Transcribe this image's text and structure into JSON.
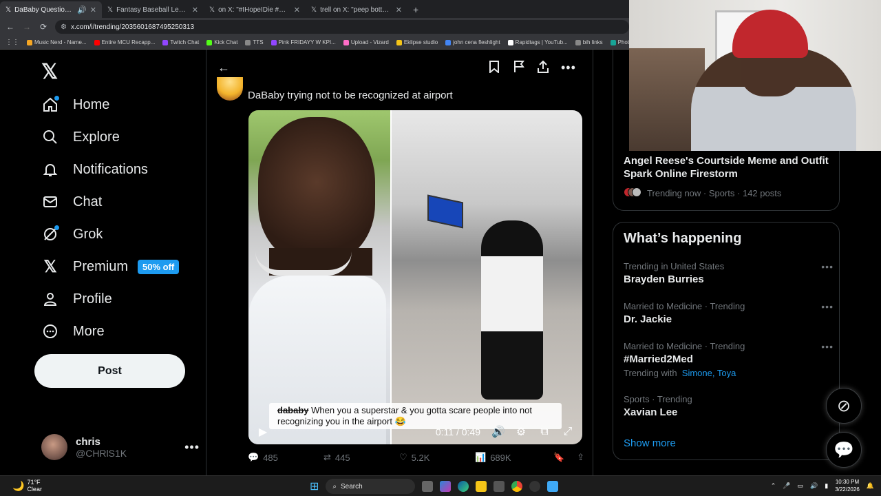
{
  "browser": {
    "tabs": [
      {
        "label": "DaBaby Questions Orange",
        "icon": "x-logo-icon",
        "active": true
      },
      {
        "label": "Fantasy Baseball League Creati",
        "icon": "x-logo-icon",
        "active": false
      },
      {
        "label": "on X: \"#IHopeIDie #WishingTh",
        "icon": "x-logo-icon",
        "active": false
      },
      {
        "label": "trell on X: \"peep bottom rig",
        "icon": "x-logo-icon",
        "active": false
      }
    ],
    "new_tab": "+",
    "url": "x.com/i/trending/2035601687495250313",
    "bookmarks": [
      {
        "label": "Music Nerd - Name...",
        "color": "#f5a623"
      },
      {
        "label": "Entire MCU Recapp...",
        "color": "#ff0000"
      },
      {
        "label": "Twitch Chat",
        "color": "#9146ff"
      },
      {
        "label": "Kick Chat",
        "color": "#53fc18"
      },
      {
        "label": "TTS",
        "color": "#888888"
      },
      {
        "label": "Pink FRIDAYY W KPI...",
        "color": "#9146ff"
      },
      {
        "label": "Upload - Vizard",
        "color": "#ff6ec7"
      },
      {
        "label": "Eklipse studio",
        "color": "#f5c518"
      },
      {
        "label": "john cena fleshlight",
        "color": "#4285f4"
      },
      {
        "label": "Rapidtags | YouTub...",
        "color": "#ffffff"
      },
      {
        "label": "bih links",
        "color": "#888888"
      },
      {
        "label": "Photopea",
        "color": "#18a497"
      }
    ]
  },
  "sidebar": {
    "items": [
      {
        "label": "Home",
        "icon": "home-icon"
      },
      {
        "label": "Explore",
        "icon": "search-icon"
      },
      {
        "label": "Notifications",
        "icon": "bell-icon"
      },
      {
        "label": "Chat",
        "icon": "mail-icon"
      },
      {
        "label": "Grok",
        "icon": "grok-icon"
      },
      {
        "label": "Premium",
        "icon": "x-logo-icon",
        "badge": "50% off"
      },
      {
        "label": "Profile",
        "icon": "person-icon"
      },
      {
        "label": "More",
        "icon": "more-circle-icon"
      }
    ],
    "post_label": "Post",
    "account": {
      "name": "chris",
      "handle": "@CHRlS1K"
    }
  },
  "tweet": {
    "text": "DaBaby trying not to be recognized at airport",
    "video": {
      "caption_user": "dababy",
      "caption_text": "When you a superstar & you gotta scare people into not recognizing you in the airport 😂",
      "time": "0:11 / 0:49"
    },
    "stats": {
      "replies": "485",
      "reposts": "445",
      "likes": "5.2K",
      "views": "689K"
    }
  },
  "right": {
    "trend_card": {
      "title": "Angel Reese's Courtside Meme and Outfit Spark Online Firestorm",
      "meta": "Trending now · Sports · 142 posts"
    },
    "whats_happening": {
      "title": "What’s happening",
      "trends": [
        {
          "meta": "Trending in United States",
          "name": "Brayden Burries"
        },
        {
          "meta": "Married to Medicine · Trending",
          "name": "Dr. Jackie"
        },
        {
          "meta": "Married to Medicine · Trending",
          "name": "#Married2Med",
          "with_label": "Trending with",
          "with_links": "Simone, Toya"
        },
        {
          "meta": "Sports · Trending",
          "name": "Xavian Lee"
        }
      ],
      "show_more": "Show more"
    }
  },
  "taskbar": {
    "weather_temp": "71°F",
    "weather_desc": "Clear",
    "search_label": "Search",
    "time": "10:30 PM",
    "date": "3/22/2026"
  },
  "colors": {
    "accent": "#1d9bf0",
    "background": "#000000",
    "text": "#e7e9ea",
    "muted": "#71767b"
  }
}
